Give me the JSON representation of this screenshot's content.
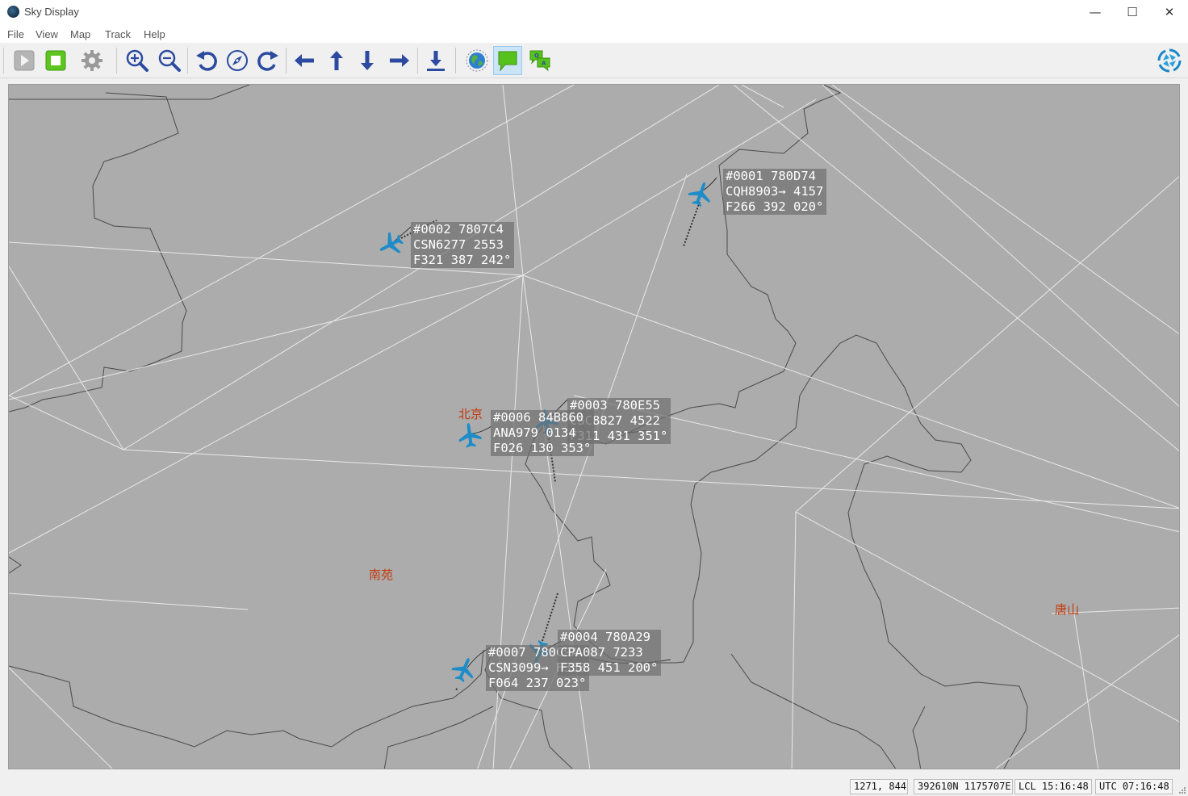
{
  "window": {
    "title": "Sky Display",
    "controls": {
      "minimize": "—",
      "maximize": "☐",
      "close": "✕"
    }
  },
  "menu": {
    "items": [
      "File",
      "View",
      "Map",
      "Track",
      "Help"
    ]
  },
  "toolbar": {
    "buttons": [
      {
        "name": "play",
        "icon": "play-icon",
        "state": "disabled"
      },
      {
        "name": "stop",
        "icon": "stop-icon",
        "color": "#5cc61f"
      },
      {
        "name": "settings",
        "icon": "gear-icon",
        "state": "disabled"
      },
      {
        "name": "zoom-in",
        "icon": "zoom-in-icon"
      },
      {
        "name": "zoom-out",
        "icon": "zoom-out-icon"
      },
      {
        "name": "rotate-left",
        "icon": "rotate-left-icon"
      },
      {
        "name": "compass",
        "icon": "compass-icon"
      },
      {
        "name": "rotate-right",
        "icon": "rotate-right-icon"
      },
      {
        "name": "pan-left",
        "icon": "arrow-left-icon"
      },
      {
        "name": "pan-up",
        "icon": "arrow-up-icon"
      },
      {
        "name": "pan-down",
        "icon": "arrow-down-icon"
      },
      {
        "name": "pan-right",
        "icon": "arrow-right-icon"
      },
      {
        "name": "download",
        "icon": "download-icon"
      },
      {
        "name": "globe",
        "icon": "globe-icon"
      },
      {
        "name": "labels",
        "icon": "speech-bubble-icon",
        "active": true
      },
      {
        "name": "qa",
        "icon": "qa-bubbles-icon"
      }
    ],
    "logo": "aperture-logo-icon",
    "icon_color": "#2b4aa0"
  },
  "map": {
    "background": "#acacac",
    "cities": [
      {
        "name": "北京"
      },
      {
        "name": "南苑"
      },
      {
        "name": "唐山"
      }
    ],
    "tracks": [
      {
        "id": "#0001",
        "hex": "780D74",
        "callsign": "CQH8903",
        "squawk": "4157",
        "trend": "→",
        "fl": "F266",
        "speed": "392",
        "heading": "020°",
        "line1": "#0001 780D74",
        "line2": "CQH8903→ 4157",
        "line3": "F266 392 020°"
      },
      {
        "id": "#0002",
        "hex": "7807C4",
        "callsign": "CSN6277",
        "squawk": "2553",
        "fl": "F321",
        "speed": "387",
        "heading": "242°",
        "line1": "#0002 7807C4",
        "line2": "CSN6277 2553",
        "line3": "F321 387 242°"
      },
      {
        "id": "#0003",
        "hex": "780E55",
        "callsign": "CSC8827",
        "squawk": "4522",
        "fl": "F311",
        "speed": "431",
        "heading": "351°",
        "line1": "#0003 780E55",
        "line2": "CSC8827 4522",
        "line3": "F311 431 351°"
      },
      {
        "id": "#0006",
        "hex": "84B860",
        "callsign": "ANA979",
        "squawk": "0134",
        "fl": "F026",
        "speed": "130",
        "heading": "353°",
        "line1": "#0006 84B860",
        "line2": "ANA979 0134",
        "line3": "F026 130 353°"
      },
      {
        "id": "#0004",
        "hex": "780A29",
        "callsign": "CPA087",
        "squawk": "7233",
        "fl": "F358",
        "speed": "451",
        "heading": "200°",
        "line1": "#0004 780A29",
        "line2": "CPA087 7233",
        "line3": "F358 451 200°"
      },
      {
        "id": "#0007",
        "hex": "780C9A",
        "callsign": "CSN3099",
        "squawk": "",
        "trend": "→",
        "fl": "F064",
        "speed": "237",
        "heading": "023°",
        "line1": "#0007 780C9A",
        "line2": "CSN3099→ F358",
        "line3": "F064 237 023°"
      }
    ],
    "plane_color": "#1e8cc8"
  },
  "status": {
    "cursor": "1271, 844",
    "position": "392610N 1175707E",
    "local_time": "LCL 15:16:48",
    "utc_time": "UTC 07:16:48"
  }
}
